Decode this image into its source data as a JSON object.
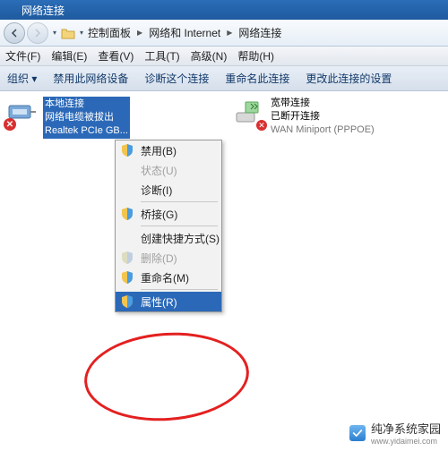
{
  "window": {
    "title": "网络连接"
  },
  "breadcrumb": {
    "items": [
      "控制面板",
      "网络和 Internet",
      "网络连接"
    ]
  },
  "menubar": {
    "file": "文件(F)",
    "edit": "编辑(E)",
    "view": "查看(V)",
    "tools": "工具(T)",
    "advanced": "高级(N)",
    "help": "帮助(H)"
  },
  "toolbar": {
    "organize": "组织 ▾",
    "disable": "禁用此网络设备",
    "diagnose": "诊断这个连接",
    "rename": "重命名此连接",
    "change": "更改此连接的设置"
  },
  "connections": {
    "local": {
      "name": "本地连接",
      "status": "网络电缆被拔出",
      "device": "Realtek PCIe GB..."
    },
    "broadband": {
      "name": "宽带连接",
      "status": "已断开连接",
      "device": "WAN Miniport (PPPOE)"
    }
  },
  "contextmenu": {
    "disable": "禁用(B)",
    "status": "状态(U)",
    "diagnose": "诊断(I)",
    "bridge": "桥接(G)",
    "shortcut": "创建快捷方式(S)",
    "delete": "删除(D)",
    "rename": "重命名(M)",
    "properties": "属性(R)"
  },
  "watermark": {
    "brand": "纯净系统家园",
    "url": "www.yidaimei.com"
  }
}
